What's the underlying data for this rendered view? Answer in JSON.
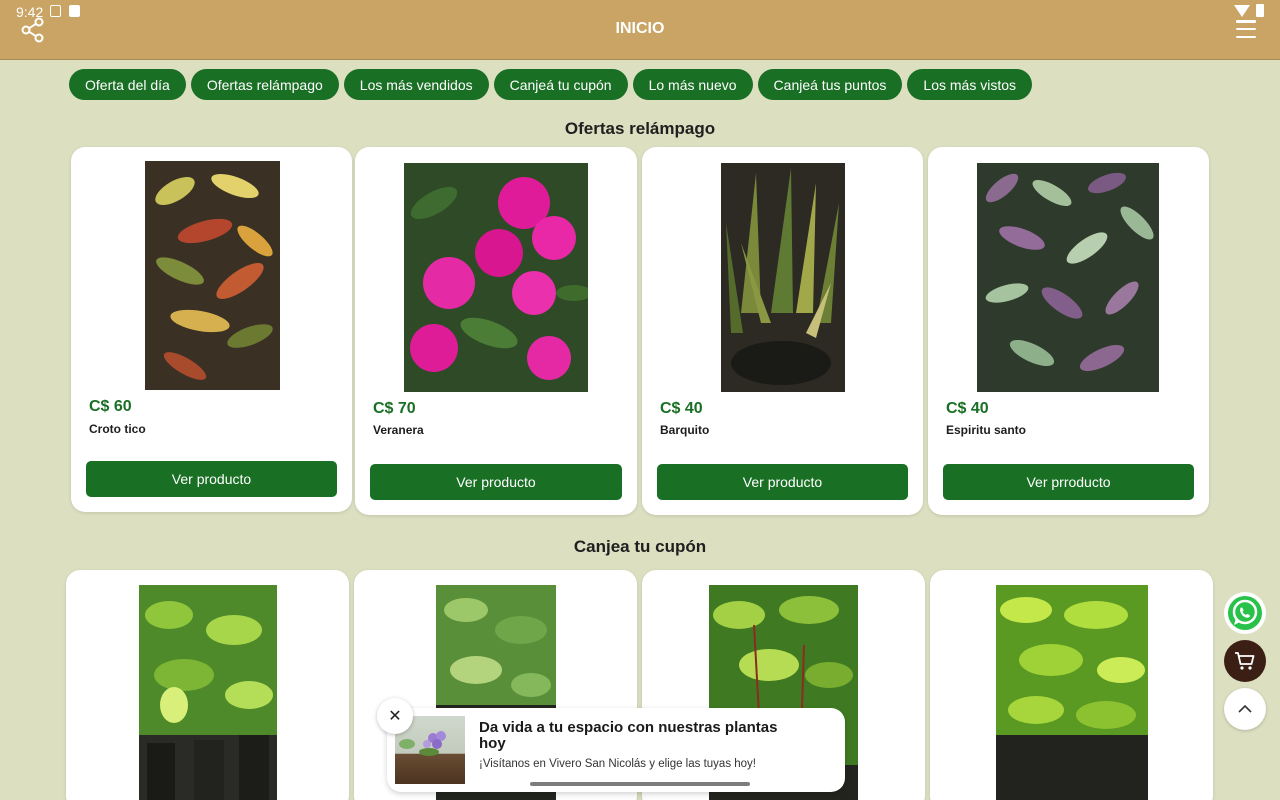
{
  "status": {
    "time": "9:42"
  },
  "header": {
    "title": "INICIO"
  },
  "chips": [
    "Oferta del día",
    "Ofertas relámpago",
    "Los más vendidos",
    "Canjeá tu cupón",
    "Lo más nuevo",
    "Canjeá tus puntos",
    "Los más vistos"
  ],
  "sections": {
    "flash": {
      "title": "Ofertas relámpago",
      "products": [
        {
          "price": "C$ 60",
          "name": "Croto tico",
          "button": "Ver producto"
        },
        {
          "price": "C$ 70",
          "name": "Veranera",
          "button": "Ver producto"
        },
        {
          "price": "C$ 40",
          "name": "Barquito",
          "button": "Ver producto"
        },
        {
          "price": "C$ 40",
          "name": "Espiritu santo",
          "button": "Ver prroducto"
        }
      ]
    },
    "coupon": {
      "title": "Canjea tu cupón"
    }
  },
  "banner": {
    "title": "Da vida a tu espacio con nuestras plantas hoy",
    "subtitle": "¡Visítanos en Vivero San Nicolás y elige las tuyas hoy!"
  },
  "colors": {
    "header": "#c9a464",
    "background": "#dcdfc0",
    "accent": "#196f24",
    "cart": "#3b1f15"
  }
}
